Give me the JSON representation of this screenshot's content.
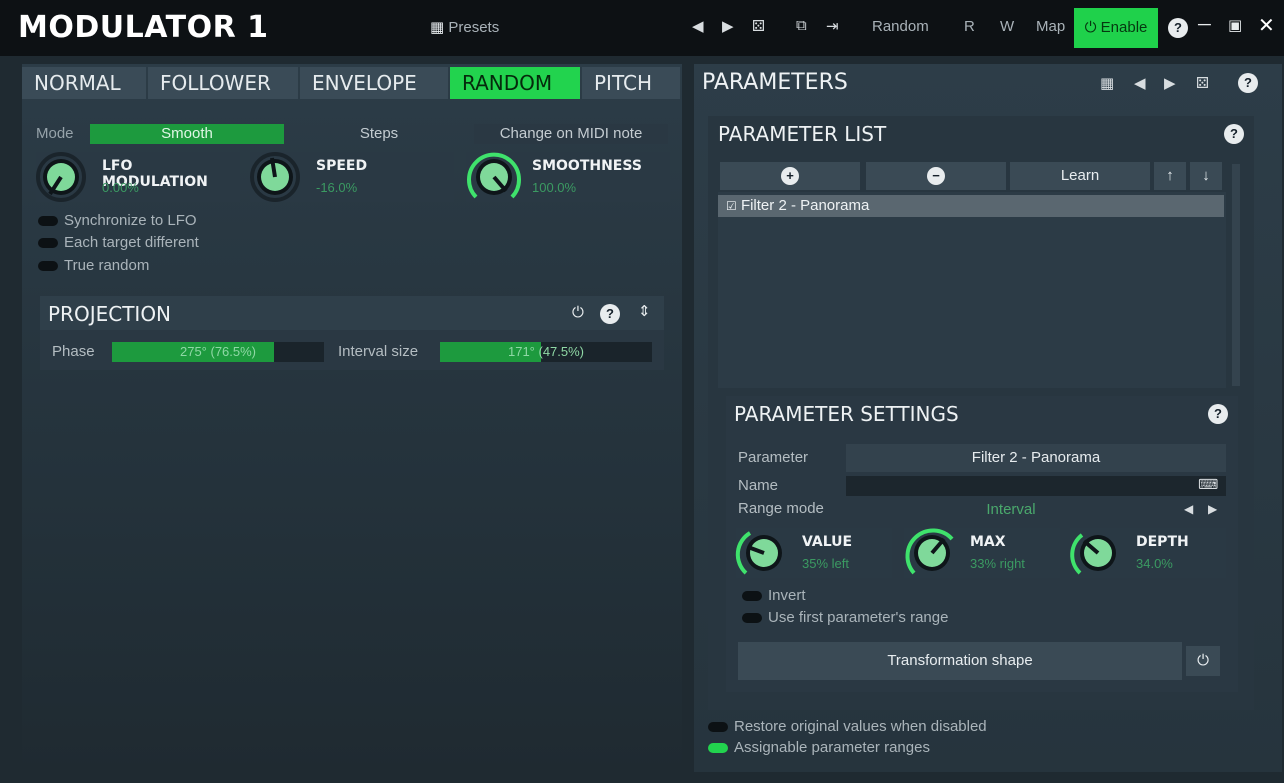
{
  "app": {
    "title": "MODULATOR 1"
  },
  "toolbar": {
    "presets_label": "Presets",
    "random_label": "Random",
    "r_label": "R",
    "w_label": "W",
    "map_label": "Map",
    "enable_label": "Enable",
    "accent": "#1fd14b"
  },
  "tabs": [
    {
      "label": "NORMAL",
      "active": false
    },
    {
      "label": "FOLLOWER",
      "active": false
    },
    {
      "label": "ENVELOPE",
      "active": false
    },
    {
      "label": "RANDOM",
      "active": true
    },
    {
      "label": "PITCH",
      "active": false
    }
  ],
  "random": {
    "mode_label": "Mode",
    "modes": [
      "Smooth",
      "Steps",
      "Change on MIDI note"
    ],
    "selected_mode": "Smooth",
    "knobs": [
      {
        "name": "LFO MODULATION",
        "value": "0.00%",
        "level": 0.0
      },
      {
        "name": "SPEED",
        "value": "-16.0%",
        "level": 0.42
      },
      {
        "name": "SMOOTHNESS",
        "value": "100.0%",
        "level": 1.0
      }
    ],
    "toggles": [
      {
        "label": "Synchronize to LFO",
        "on": false
      },
      {
        "label": "Each target different",
        "on": false
      },
      {
        "label": "True random",
        "on": false
      }
    ]
  },
  "projection": {
    "title": "PROJECTION",
    "phase_label": "Phase",
    "phase_value": "275° (76.5%)",
    "phase_fraction": 0.765,
    "interval_label": "Interval size",
    "interval_value": "171° (47.5%)",
    "interval_fraction": 0.475
  },
  "parameters": {
    "title": "PARAMETERS",
    "list_title": "PARAMETER LIST",
    "learn_label": "Learn",
    "items": [
      "Filter 2 - Panorama"
    ],
    "settings": {
      "title": "PARAMETER SETTINGS",
      "parameter_label": "Parameter",
      "parameter_value": "Filter 2 - Panorama",
      "name_label": "Name",
      "name_value": "",
      "range_mode_label": "Range mode",
      "range_mode_value": "Interval",
      "knobs": [
        {
          "name": "VALUE",
          "value": "35% left",
          "level": 0.35
        },
        {
          "name": "MAX",
          "value": "33% right",
          "level": 0.66
        },
        {
          "name": "DEPTH",
          "value": "34.0%",
          "level": 0.34
        }
      ],
      "toggles": [
        {
          "label": "Invert",
          "on": false
        },
        {
          "label": "Use first parameter's range",
          "on": false
        }
      ],
      "transformation_label": "Transformation shape"
    },
    "bottom_toggles": [
      {
        "label": "Restore original values when disabled",
        "on": false
      },
      {
        "label": "Assignable parameter ranges",
        "on": true
      }
    ]
  }
}
